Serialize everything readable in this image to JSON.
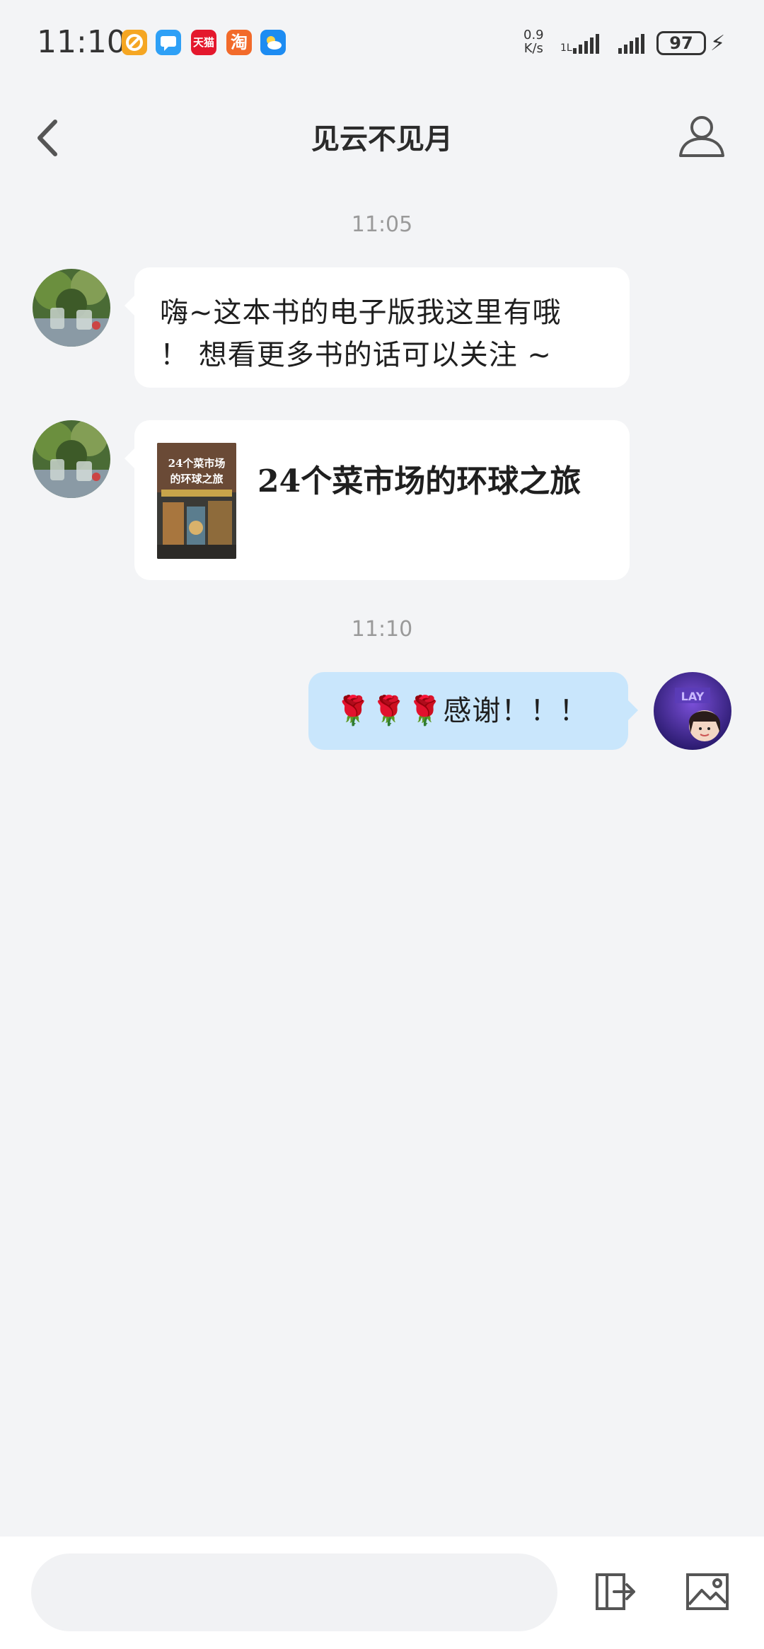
{
  "status_bar": {
    "time": "11:10",
    "net_speed_value": "0.9",
    "net_speed_unit": "K/s",
    "battery": "97",
    "app_icons": [
      {
        "name": "app-icon-orange",
        "color": "#f5a623"
      },
      {
        "name": "app-icon-message",
        "color": "#2ea0f6"
      },
      {
        "name": "app-icon-tmall",
        "color": "#e4182d",
        "label": "天猫"
      },
      {
        "name": "app-icon-taobao",
        "color": "#f26a2a",
        "label": "淘"
      },
      {
        "name": "app-icon-weather",
        "color": "#1d8cf2"
      }
    ]
  },
  "header": {
    "title": "见云不见月",
    "back_icon": "chevron-left-icon",
    "profile_icon": "person-icon"
  },
  "messages": [
    {
      "type": "timestamp",
      "text": "11:05"
    },
    {
      "type": "text",
      "side": "left",
      "lines": [
        "嗨~这本书的电子版我这里有哦",
        "！ 想看更多书的话可以关注 ~"
      ]
    },
    {
      "type": "book",
      "side": "left",
      "title": "24个菜市场的环球之旅",
      "cover_title": "24个菜市场的环球之旅"
    },
    {
      "type": "timestamp",
      "text": "11:10"
    },
    {
      "type": "text",
      "side": "right",
      "text": "🌹🌹🌹感谢！！！"
    }
  ],
  "composer": {
    "placeholder": "",
    "export_icon": "export-icon",
    "image_icon": "image-icon"
  },
  "colors": {
    "background": "#f3f4f6",
    "incoming_bubble": "#ffffff",
    "outgoing_bubble": "#c9e6fc"
  }
}
